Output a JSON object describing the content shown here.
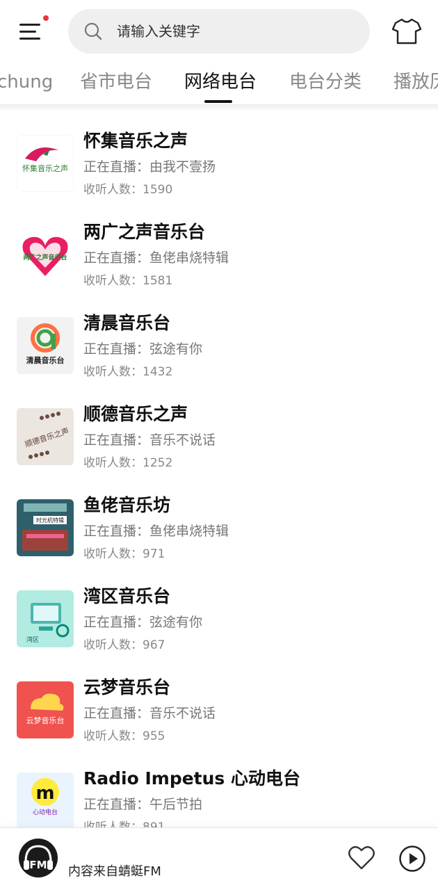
{
  "header": {
    "search_placeholder": "请输入关键字",
    "menu_icon": "menu-icon",
    "shirt_icon": "shirt-icon",
    "notification_color": "#e53935"
  },
  "tabs": [
    {
      "label": "chung",
      "active": false
    },
    {
      "label": "省市电台",
      "active": false
    },
    {
      "label": "网络电台",
      "active": true
    },
    {
      "label": "电台分类",
      "active": false
    },
    {
      "label": "播放历",
      "active": false
    }
  ],
  "stations": [
    {
      "name": "怀集音乐之声",
      "live": "正在直播：由我不壹扬",
      "listeners": "收听人数：1590",
      "logo_text": "怀集音乐之声"
    },
    {
      "name": "两广之声音乐台",
      "live": "正在直播：鱼佬串烧特辑",
      "listeners": "收听人数：1581",
      "logo_text": "两广之声音乐台"
    },
    {
      "name": "清晨音乐台",
      "live": "正在直播：弦途有你",
      "listeners": "收听人数：1432",
      "logo_text": "清晨音乐台"
    },
    {
      "name": "顺德音乐之声",
      "live": "正在直播：音乐不说话",
      "listeners": "收听人数：1252",
      "logo_text": "顺德音乐之声"
    },
    {
      "name": "鱼佬音乐坊",
      "live": "正在直播：鱼佬串烧特辑",
      "listeners": "收听人数：971",
      "logo_text": "时光机特辑"
    },
    {
      "name": "湾区音乐台",
      "live": "正在直播：弦途有你",
      "listeners": "收听人数：967",
      "logo_text": "湾区"
    },
    {
      "name": "云梦音乐台",
      "live": "正在直播：音乐不说话",
      "listeners": "收听人数：955",
      "logo_text": "云梦音乐台"
    },
    {
      "name": "Radio Impetus 心动电台",
      "live": "正在直播：午后节拍",
      "listeners": "收听人数：891",
      "logo_text": "心动电台"
    }
  ],
  "player": {
    "source": "内容来自蜻蜓FM",
    "logo_text": "FM",
    "heart_icon": "heart-icon",
    "play_icon": "play-icon"
  }
}
